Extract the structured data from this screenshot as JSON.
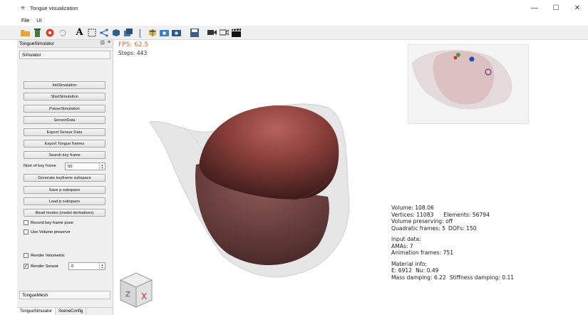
{
  "window": {
    "title": "Tongue visualization",
    "controls": [
      "—",
      "☐",
      "✕"
    ]
  },
  "menu": [
    "File",
    "UI"
  ],
  "toolbar": {
    "icons": [
      "open-folder-icon",
      "delete-icon",
      "record-icon",
      "undo-icon",
      "text-icon",
      "select-box-icon",
      "share-icon",
      "cube-icon",
      "layers-icon",
      "bracket-icon",
      "mesh-icon",
      "camera-icon",
      "camera-alt-icon",
      "save-icon",
      "video-icon",
      "film-icon",
      "clapper-icon"
    ]
  },
  "dock": {
    "title": "TongueSimulator",
    "section_label": "Simulator",
    "buttons": {
      "init": "InitSimulation",
      "start": "StartSimulation",
      "pause": "PauseSimulation",
      "sensor": "SensorData",
      "export_sensor": "Export Sensor Data",
      "export_frames": "Export Tongue frames",
      "search_key": "Search key frame",
      "gen_subspace": "Generate keyframe subspace",
      "save_sub": "Save p subspace",
      "load_sub": "Load p subspace",
      "read_modes": "Read modes (modal derivatives)"
    },
    "num_key_frame_label": "Num of key frame",
    "num_key_frame_value": "50",
    "checks": {
      "record": {
        "label": "Record key frame pose",
        "checked": false
      },
      "volume": {
        "label": "Use Volume preserve",
        "checked": false
      },
      "render_vol": {
        "label": "Render Volumetric",
        "checked": false
      },
      "render_sensor": {
        "label": "Render Sensor",
        "checked": true
      }
    },
    "render_sensor_value": "0",
    "mesh_label": "TongueMesh",
    "tabs": [
      "TongueSimulator",
      "SceneConfig"
    ]
  },
  "viewport": {
    "fps": "FPS: 62.5",
    "steps": "Steps: 443",
    "info": {
      "volume": "Volume: 108.06",
      "vertices": "Vertices: 11083",
      "elements": "Elements: 56794",
      "volume_pres": "Volume preserving: off",
      "quad": "Quadratic frames: 5",
      "dofs": "DOFs: 150",
      "input": "Input data:",
      "amas": "AMAs: 7",
      "anim": "Animation frames: 751",
      "material": "Material info:",
      "e": "E: 6912",
      "nu": "Nu: 0.49",
      "mass": "Mass damping: 6.22",
      "stiff": "Stiffness damping: 0.11"
    },
    "cube_axis_labels": [
      "Z",
      "X"
    ],
    "colors": {
      "fps": "#d06a3b",
      "tongue": "#8a3f3b",
      "tissue": "#e6e6e6"
    }
  }
}
